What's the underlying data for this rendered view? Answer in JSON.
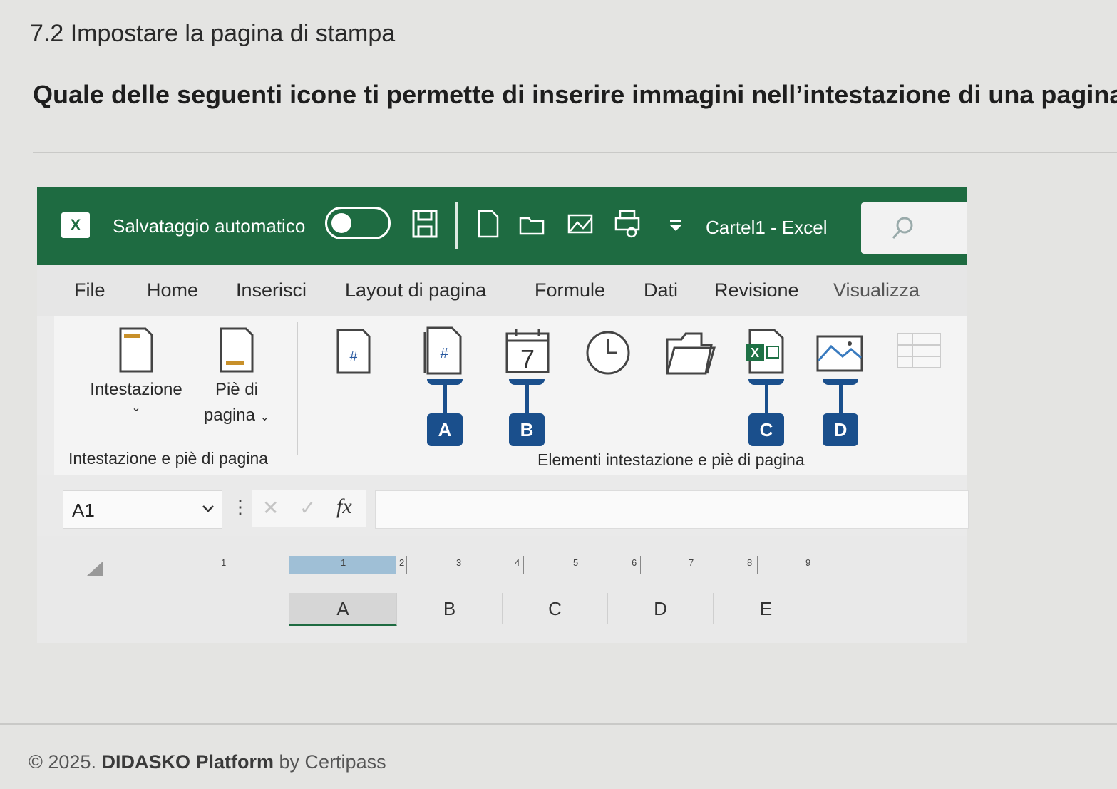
{
  "page": {
    "section_title": "7.2 Impostare la pagina di stampa",
    "question": "Quale delle seguenti icone ti permette di inserire immagini nell’intestazione di una pagina?"
  },
  "excel": {
    "titlebar": {
      "app_icon": "excel-logo-icon",
      "app_icon_text": "X",
      "autosave_label": "Salvataggio automatico",
      "autosave_state": "off",
      "quick_access_icons": [
        "save-icon",
        "new-document-icon",
        "open-folder-icon",
        "picture-icon",
        "print-preview-icon",
        "customize-qat-icon"
      ],
      "document_title": "Cartel1 - Excel",
      "search_icon": "search-icon",
      "brand_color": "#1e6b41"
    },
    "tabs": [
      "File",
      "Home",
      "Inserisci",
      "Layout di pagina",
      "Formule",
      "Dati",
      "Revisione",
      "Visualizza"
    ],
    "ribbon": {
      "group1": {
        "label": "Intestazione e piè di pagina",
        "header_button": "Intestazione",
        "footer_button_line1": "Piè di",
        "footer_button_line2": "pagina",
        "dropdown_glyph": "⌄"
      },
      "group2": {
        "label": "Elementi intestazione e piè di pagina",
        "icons": [
          "page-number-icon",
          "page-count-icon",
          "current-date-icon",
          "current-time-icon",
          "file-path-icon",
          "file-name-icon",
          "sheet-name-icon",
          "picture-icon",
          "format-picture-icon"
        ],
        "page_number_glyph": "#",
        "date_glyph": "7",
        "callouts": [
          "A",
          "B",
          "C",
          "D"
        ],
        "callout_color": "#1a4f8c"
      }
    },
    "formula_bar": {
      "name_box": "A1",
      "cancel_glyph": "✕",
      "enter_glyph": "✓",
      "fx_label": "fx",
      "formula_value": ""
    },
    "ruler": [
      "1",
      "1",
      "2",
      "3",
      "4",
      "5",
      "6",
      "7",
      "8",
      "9"
    ],
    "columns": [
      "A",
      "B",
      "C",
      "D",
      "E"
    ]
  },
  "footer": {
    "copyright": "© 2025.",
    "platform": "DIDASKO Platform",
    "by": "by Certipass"
  }
}
